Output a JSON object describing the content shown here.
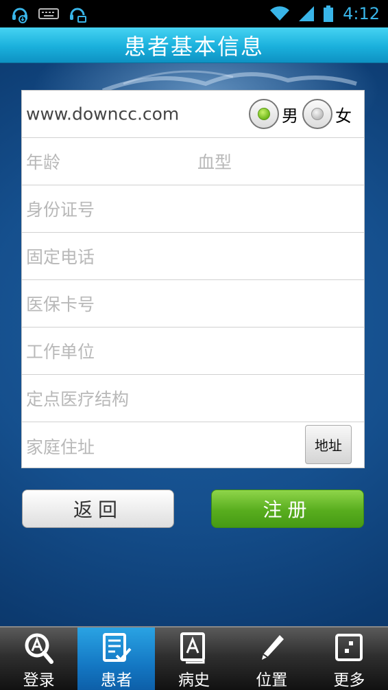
{
  "status_bar": {
    "time": "4:12"
  },
  "title": "患者基本信息",
  "form": {
    "name_value": "www.downcc.com",
    "gender_male": "男",
    "gender_female": "女",
    "age_placeholder": "年龄",
    "blood_type_placeholder": "血型",
    "id_number_placeholder": "身份证号",
    "landline_placeholder": "固定电话",
    "insurance_card_placeholder": "医保卡号",
    "workplace_placeholder": "工作单位",
    "hospital_placeholder": "定点医疗结构",
    "address_placeholder": "家庭住址",
    "address_button": "地址"
  },
  "actions": {
    "back": "返回",
    "register": "注册"
  },
  "tabbar": {
    "items": [
      {
        "label": "登录",
        "icon": "login-icon"
      },
      {
        "label": "患者",
        "icon": "patient-icon"
      },
      {
        "label": "病史",
        "icon": "history-icon"
      },
      {
        "label": "位置",
        "icon": "location-icon"
      },
      {
        "label": "更多",
        "icon": "more-icon"
      }
    ],
    "active_index": 1
  },
  "colors": {
    "accent": "#1ab0dc",
    "register_green": "#58ad1e",
    "active_tab": "#1478c4"
  }
}
